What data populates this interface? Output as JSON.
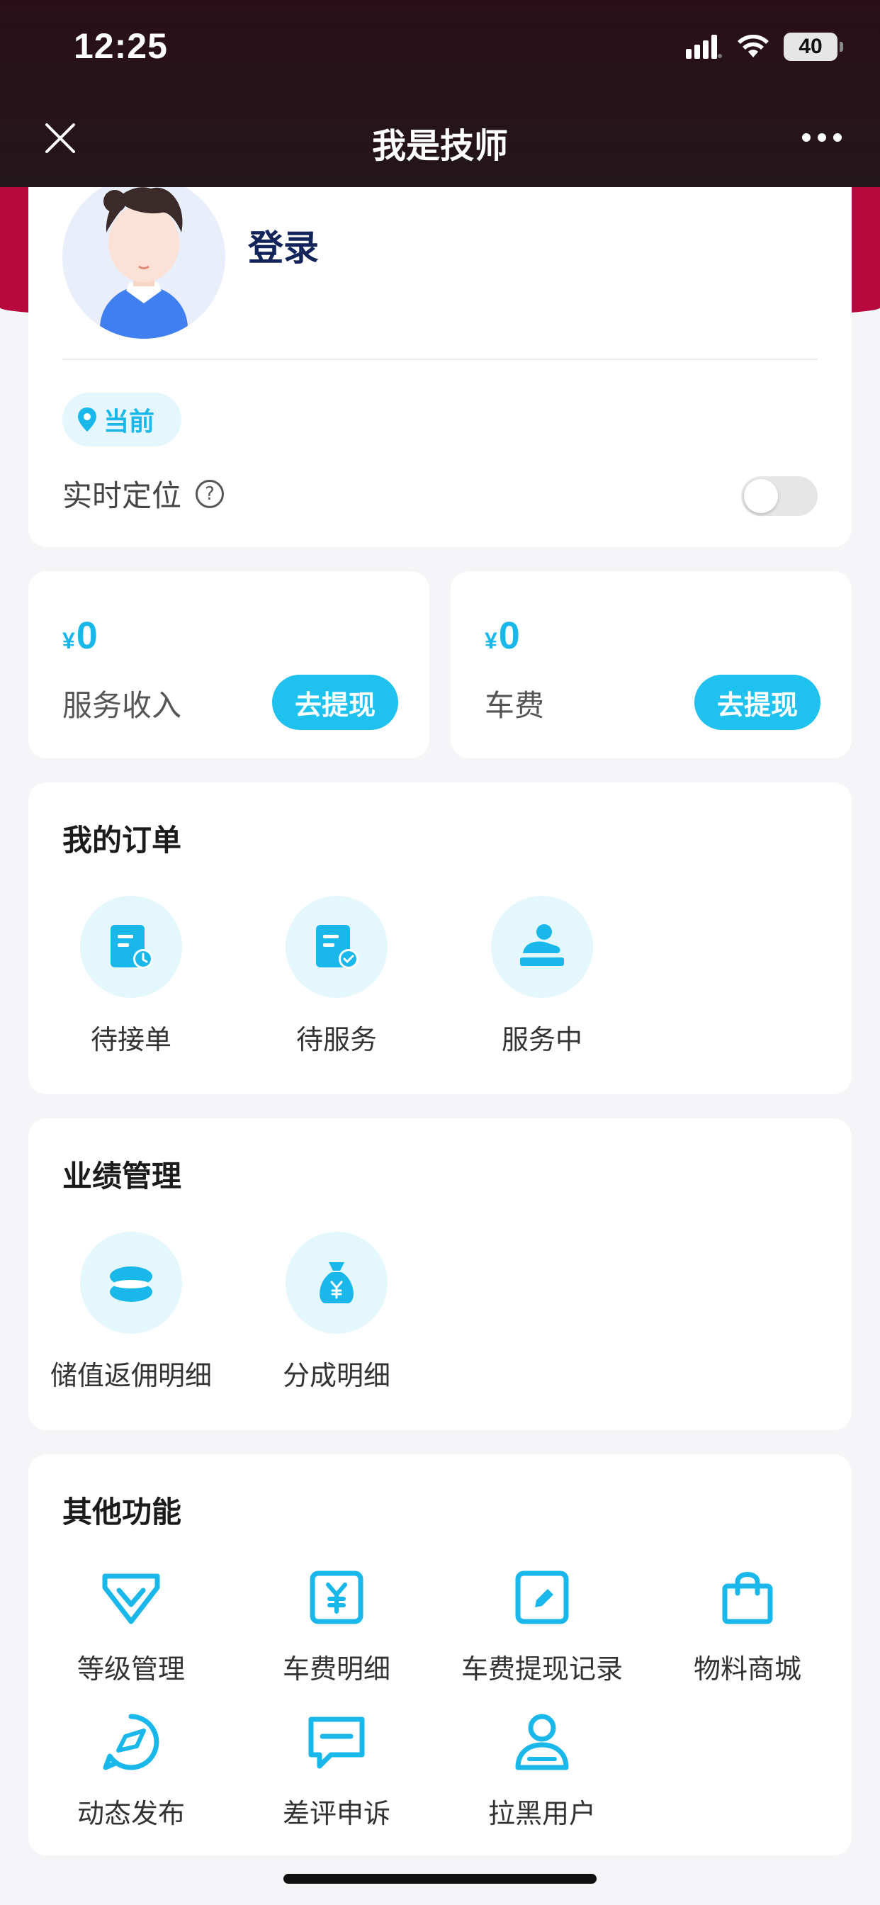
{
  "status": {
    "time": "12:25",
    "battery": "40"
  },
  "nav": {
    "title": "我是技师"
  },
  "profile": {
    "login": "登录",
    "location_chip": "当前",
    "realtime_label": "实时定位",
    "help_glyph": "?",
    "realtime_on": false
  },
  "income": {
    "currency": "¥",
    "service_amount": "0",
    "service_label": "服务收入",
    "car_amount": "0",
    "car_label": "车费",
    "withdraw_label": "去提现"
  },
  "orders": {
    "title": "我的订单",
    "items": [
      {
        "label": "待接单",
        "icon": "pending-order-icon"
      },
      {
        "label": "待服务",
        "icon": "pending-service-icon"
      },
      {
        "label": "服务中",
        "icon": "in-service-icon"
      }
    ]
  },
  "performance": {
    "title": "业绩管理",
    "items": [
      {
        "label": "储值返佣明细",
        "icon": "coins-icon"
      },
      {
        "label": "分成明细",
        "icon": "money-bag-icon"
      }
    ]
  },
  "other": {
    "title": "其他功能",
    "items": [
      {
        "label": "等级管理",
        "icon": "diamond-icon"
      },
      {
        "label": "车费明细",
        "icon": "yen-receipt-icon"
      },
      {
        "label": "车费提现记录",
        "icon": "edit-icon"
      },
      {
        "label": "物料商城",
        "icon": "shopping-bag-icon"
      },
      {
        "label": "动态发布",
        "icon": "compass-icon"
      },
      {
        "label": "差评申诉",
        "icon": "message-icon"
      },
      {
        "label": "拉黑用户",
        "icon": "user-icon"
      }
    ]
  },
  "colors": {
    "accent": "#1fc1ef",
    "header": "#23161b",
    "banner": "#b8093e"
  }
}
